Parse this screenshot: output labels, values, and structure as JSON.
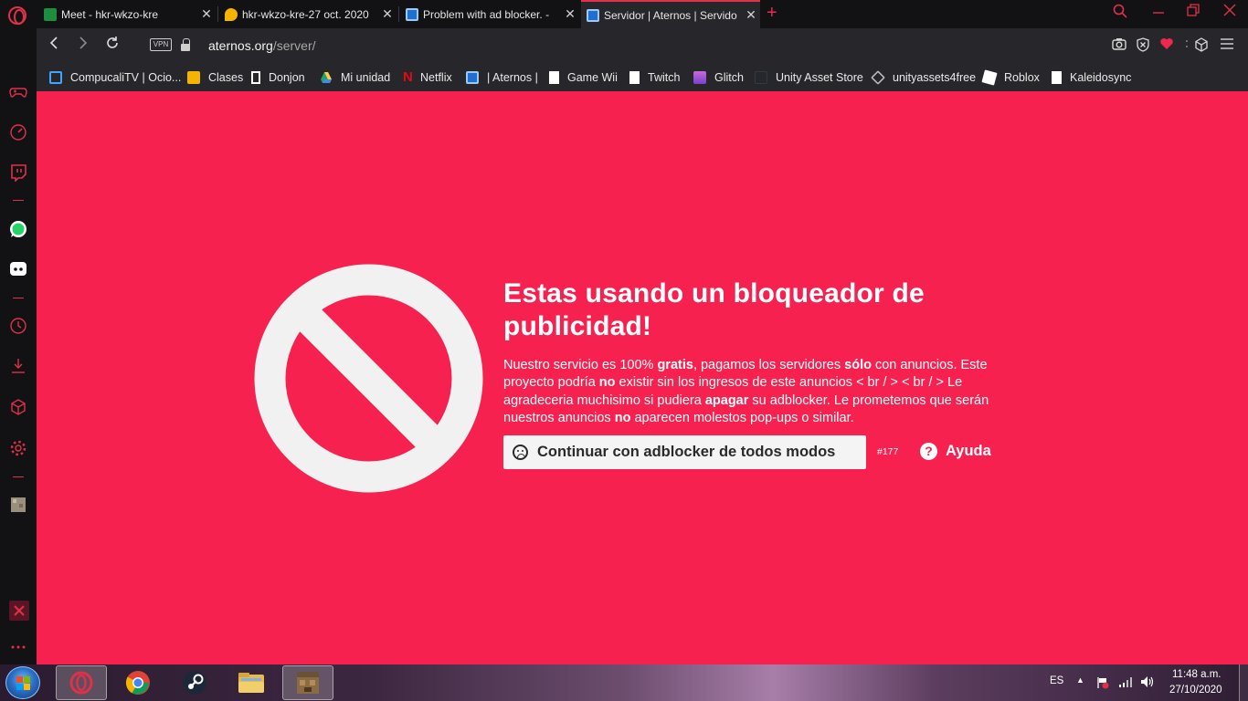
{
  "tabs": [
    {
      "title": "Meet - hkr-wkzo-kre",
      "close": "✕",
      "color": "#1e8e3e",
      "active": false
    },
    {
      "title": "hkr-wkzo-kre-27 oct. 2020",
      "close": "✕",
      "color": "#f4b400",
      "active": false
    },
    {
      "title": "Problem with ad blocker. -",
      "close": "✕",
      "color": "#1f6fd1",
      "active": false
    },
    {
      "title": "Servidor | Aternos | Servido",
      "close": "✕",
      "color": "#1f6fd1",
      "active": true
    }
  ],
  "address_bar": {
    "vpn_label": "VPN",
    "url_domain": "aternos.org",
    "url_path": "/server/"
  },
  "bookmarks": [
    {
      "label": "CompucaliTV | Ocio...",
      "icon": "tv-icon",
      "color": "#3ea6ff"
    },
    {
      "label": "Clases",
      "icon": "classroom-icon",
      "color": "#f4b400"
    },
    {
      "label": "Donjon",
      "icon": "tower-icon",
      "color": "#ffffff"
    },
    {
      "label": "Mi unidad",
      "icon": "drive-icon",
      "color": "#1fa463"
    },
    {
      "label": "Netflix",
      "icon": "netflix-icon",
      "color": "#e50914"
    },
    {
      "label": "| Aternos |",
      "icon": "aternos-icon",
      "color": "#1f6fd1"
    },
    {
      "label": "Game Wii",
      "icon": "page-icon",
      "color": "#ffffff"
    },
    {
      "label": "Twitch",
      "icon": "page-icon",
      "color": "#ffffff"
    },
    {
      "label": "Glitch",
      "icon": "glitch-icon",
      "color": "#c76bd6"
    },
    {
      "label": "Unity Asset Store",
      "icon": "unity-icon",
      "color": "#2a2a2a"
    },
    {
      "label": "unityassets4free",
      "icon": "unity-icon",
      "color": "#bbbbbb"
    },
    {
      "label": "Roblox",
      "icon": "roblox-icon",
      "color": "#ffffff"
    },
    {
      "label": "Kaleidosync",
      "icon": "page-icon",
      "color": "#ffffff"
    }
  ],
  "sidebar_icons": [
    "gamepad-icon",
    "speed-dial-icon",
    "twitch-icon",
    "whatsapp-icon",
    "discord-icon",
    "history-icon",
    "downloads-icon",
    "extensions-icon",
    "settings-icon",
    "minecraft-icon",
    "opera-gx-icon",
    "more-icon"
  ],
  "page": {
    "heading": "Estas usando un bloqueador de publicidad!",
    "body": {
      "s1": "Nuestro servicio es 100% ",
      "b1": "gratis",
      "s2": ", pagamos los servidores ",
      "b2": "sólo",
      "s3": " con anuncios. Este proyecto podría ",
      "b3": "no",
      "s4": " existir sin los ingresos de este anuncios < br / > < br / > Le agradeceria muchisimo si pudiera ",
      "b4": "apagar",
      "s5": " su adblocker. Le prometemos que serán nuestros anuncios ",
      "b5": "no",
      "s6": " aparecen molestos pop-ups o similar."
    },
    "continue_label": "Continuar con adblocker de todos modos",
    "counter": "#177",
    "help_icon": "?",
    "help_label": "Ayuda",
    "accent": "#f7214f"
  },
  "taskbar": {
    "language": "ES",
    "time": "11:48 a.m.",
    "date": "27/10/2020",
    "apps": [
      "opera-gx-icon",
      "chrome-icon",
      "steam-icon",
      "file-explorer-icon",
      "minecraft-icon"
    ]
  }
}
